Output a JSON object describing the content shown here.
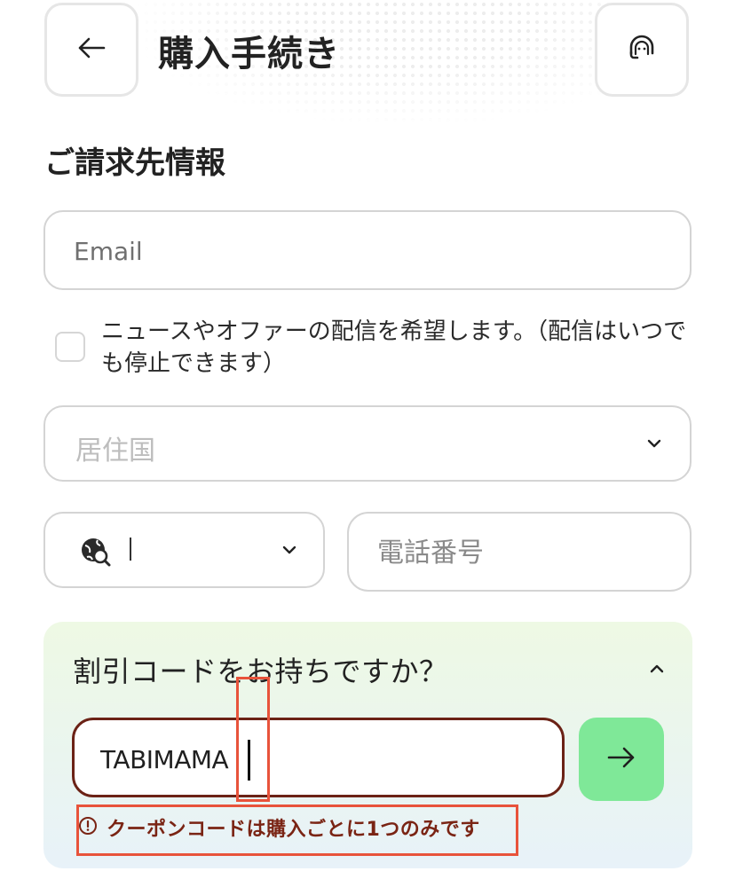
{
  "header": {
    "title": "購入手続き",
    "back_icon": "arrow-left-icon",
    "support_icon": "headset-icon"
  },
  "billing": {
    "section_title": "ご請求先情報",
    "email_placeholder": "Email",
    "newsletter_label": "ニュースやオファーの配信を希望します。（配信はいつでも停止できます）",
    "country_placeholder": "居住国",
    "dial_code_icon": "globe-search-icon",
    "phone_placeholder": "電話番号"
  },
  "discount": {
    "title": "割引コードをお持ちですか？",
    "coupon_value": "TABIMAMA",
    "submit_icon": "arrow-right-icon",
    "error_message": "クーポンコードは購入ごとに1つのみです"
  },
  "colors": {
    "error": "#7a2414",
    "coupon_border": "#6b2216",
    "submit_bg": "#7fe898",
    "highlight": "#e8533b"
  }
}
